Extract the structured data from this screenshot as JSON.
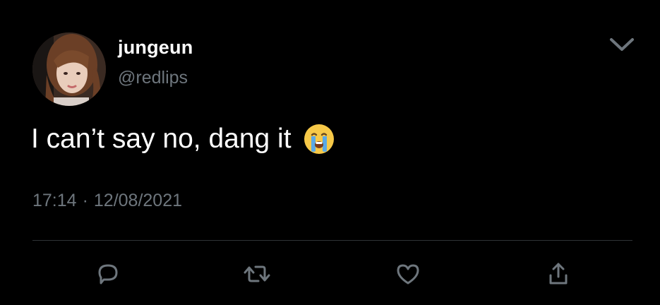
{
  "user": {
    "display_name": "jungeun",
    "handle": "@redlips"
  },
  "tweet": {
    "text": "I can’t say no, dang it",
    "emoji": "loudly-crying-face",
    "time": "17:14",
    "separator": "·",
    "date": "12/08/2021"
  },
  "icons": {
    "more": "chevron-down-icon",
    "reply": "reply-icon",
    "retweet": "retweet-icon",
    "like": "heart-icon",
    "share": "share-icon"
  },
  "colors": {
    "background": "#000000",
    "primary_text": "#ffffff",
    "secondary_text": "#6e767d",
    "divider": "#2f3336"
  }
}
